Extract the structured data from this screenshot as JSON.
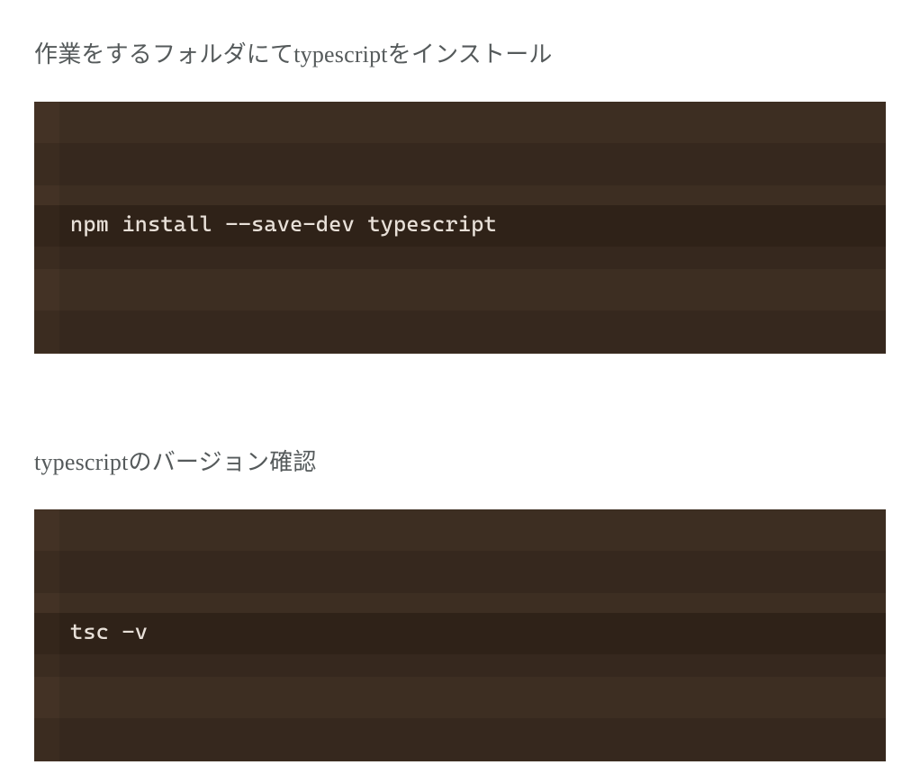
{
  "sections": [
    {
      "heading": "作業をするフォルダにてtypescriptをインストール",
      "code": "npm install --save-dev typescript"
    },
    {
      "heading": "typescriptのバージョン確認",
      "code": "tsc -v"
    }
  ]
}
